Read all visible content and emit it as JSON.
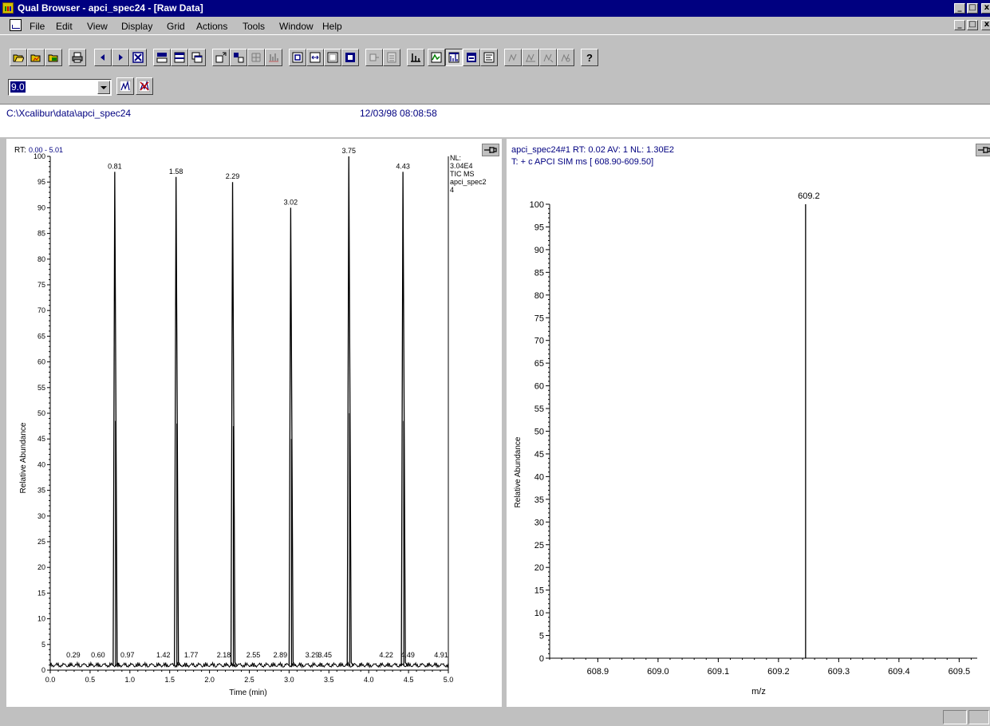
{
  "window": {
    "title": "Qual Browser - apci_spec24 - [Raw Data]"
  },
  "menu": [
    "File",
    "Edit",
    "View",
    "Display",
    "Grid",
    "Actions",
    "Tools",
    "Window",
    "Help"
  ],
  "toolbar": {
    "combo_value": "9.0",
    "icons": [
      "open-icon",
      "open-raw-icon",
      "open-layout-icon",
      "print-icon",
      "previous-icon",
      "next-icon",
      "reset-scaling-icon",
      "pin-tile-icon",
      "tile-horizontal-icon",
      "tile-cascade-icon",
      "insert-cell-icon",
      "delete-cell-icon",
      "grid-icon",
      "spectrum-peaks-icon",
      "zoom-in-icon",
      "zoom-horizontal-icon",
      "zoom-out-icon",
      "zoom-reset-icon",
      "export-icon",
      "calculator-icon",
      "mass-range-icon",
      "chromatogram-view-icon",
      "spectrum-view-icon",
      "map-view-icon",
      "scan-header-icon",
      "ranges-icon",
      "peak-detect-icon",
      "library-search-icon",
      "elemental-icon",
      "help-icon"
    ]
  },
  "info": {
    "path": "C:\\Xcalibur\\data\\apci_spec24",
    "datetime": "12/03/98 08:08:58"
  },
  "chromatogram": {
    "rt_prefix": "RT: ",
    "rt_range": "0.00 - 5.01",
    "nl_lines": [
      "NL:",
      "3.04E4",
      "TIC MS",
      "apci_spec2",
      "4"
    ],
    "ylabel": "Relative Abundance",
    "xlabel": "Time (min)"
  },
  "spectrum": {
    "header1": "apci_spec24#1  RT: 0.02  AV: 1  NL: 1.30E2",
    "header2": "T: + c APCI SIM ms [ 608.90-609.50]",
    "ylabel": "Relative Abundance",
    "xlabel": "m/z"
  },
  "chart_data": [
    {
      "type": "line",
      "title": "RT: 0.00 - 5.01",
      "xlabel": "Time (min)",
      "ylabel": "Relative Abundance",
      "xlim": [
        0.0,
        5.0
      ],
      "ylim": [
        0,
        100
      ],
      "x_ticks": [
        0.0,
        0.5,
        1.0,
        1.5,
        2.0,
        2.5,
        3.0,
        3.5,
        4.0,
        4.5,
        5.0
      ],
      "y_ticks": [
        0,
        5,
        10,
        15,
        20,
        25,
        30,
        35,
        40,
        45,
        50,
        55,
        60,
        65,
        70,
        75,
        80,
        85,
        90,
        95,
        100
      ],
      "peaks": [
        {
          "x": 0.81,
          "y": 97,
          "label": "0.81"
        },
        {
          "x": 1.58,
          "y": 96,
          "label": "1.58"
        },
        {
          "x": 2.29,
          "y": 95,
          "label": "2.29"
        },
        {
          "x": 3.02,
          "y": 90,
          "label": "3.02"
        },
        {
          "x": 3.75,
          "y": 100,
          "label": "3.75"
        },
        {
          "x": 4.43,
          "y": 97,
          "label": "4.43"
        }
      ],
      "minor_labels": [
        {
          "x": 0.29,
          "label": "0.29"
        },
        {
          "x": 0.6,
          "label": "0.60"
        },
        {
          "x": 0.97,
          "label": "0.97"
        },
        {
          "x": 1.42,
          "label": "1.42"
        },
        {
          "x": 1.77,
          "label": "1.77"
        },
        {
          "x": 2.18,
          "label": "2.18"
        },
        {
          "x": 2.55,
          "label": "2.55"
        },
        {
          "x": 2.89,
          "label": "2.89"
        },
        {
          "x": 3.29,
          "label": "3.29"
        },
        {
          "x": 3.45,
          "label": "3.45"
        },
        {
          "x": 4.22,
          "label": "4.22"
        },
        {
          "x": 4.49,
          "label": "4.49"
        },
        {
          "x": 4.91,
          "label": "4.91"
        }
      ],
      "grid": false
    },
    {
      "type": "bar",
      "title": "apci_spec24#1  RT: 0.02  AV: 1  NL: 1.30E2",
      "xlabel": "m/z",
      "ylabel": "Relative Abundance",
      "xlim": [
        608.82,
        609.53
      ],
      "ylim": [
        0,
        100
      ],
      "x_ticks": [
        608.9,
        609.0,
        609.1,
        609.2,
        609.3,
        609.4,
        609.5
      ],
      "y_ticks": [
        0,
        5,
        10,
        15,
        20,
        25,
        30,
        35,
        40,
        45,
        50,
        55,
        60,
        65,
        70,
        75,
        80,
        85,
        90,
        95,
        100
      ],
      "peaks": [
        {
          "x": 609.245,
          "y": 100,
          "label": "609.2"
        }
      ],
      "grid": false
    }
  ]
}
